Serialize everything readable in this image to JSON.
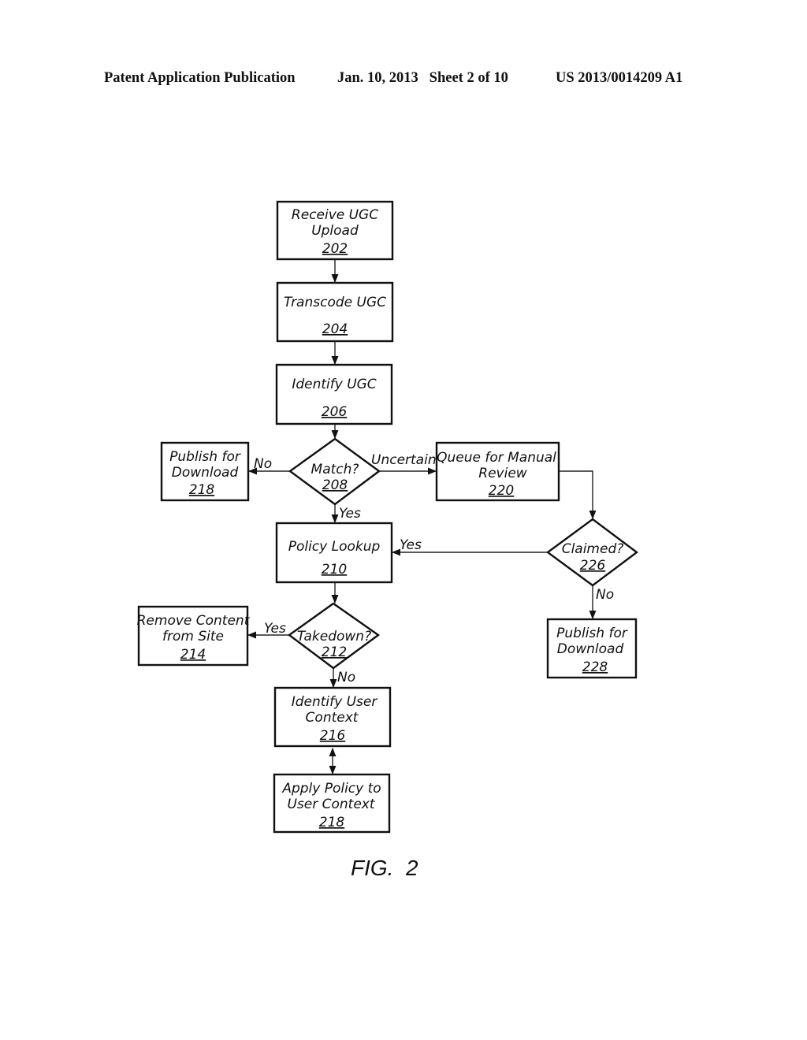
{
  "header": {
    "publication": "Patent Application Publication",
    "date_sheet": "Jan. 10, 2013   Sheet 2 of 10",
    "number": "US 2013/0014209 A1"
  },
  "figure_label": "FIG.  2",
  "nodes": {
    "n202": {
      "lines": [
        "Receive UGC",
        "Upload"
      ],
      "ref": "202"
    },
    "n204": {
      "lines": [
        "Transcode UGC"
      ],
      "ref": "204"
    },
    "n206": {
      "lines": [
        "Identify UGC"
      ],
      "ref": "206"
    },
    "n208": {
      "lines": [
        "Match?"
      ],
      "ref": "208"
    },
    "n218a": {
      "lines": [
        "Publish for",
        "Download"
      ],
      "ref": "218"
    },
    "n220": {
      "lines": [
        "Queue for Manual",
        "Review"
      ],
      "ref": "220"
    },
    "n226": {
      "lines": [
        "Claimed?"
      ],
      "ref": "226"
    },
    "n210": {
      "lines": [
        "Policy Lookup"
      ],
      "ref": "210"
    },
    "n228": {
      "lines": [
        "Publish for",
        "Download"
      ],
      "ref": "228"
    },
    "n212": {
      "lines": [
        "Takedown?"
      ],
      "ref": "212"
    },
    "n214": {
      "lines": [
        "Remove Content",
        "from Site"
      ],
      "ref": "214"
    },
    "n216": {
      "lines": [
        "Identify User",
        "Context"
      ],
      "ref": "216"
    },
    "n218b": {
      "lines": [
        "Apply Policy to",
        "User Context"
      ],
      "ref": "218"
    }
  },
  "edges": {
    "match_no": "No",
    "match_uncertain": "Uncertain",
    "match_yes": "Yes",
    "claimed_yes": "Yes",
    "claimed_no": "No",
    "takedown_yes": "Yes",
    "takedown_no": "No"
  }
}
